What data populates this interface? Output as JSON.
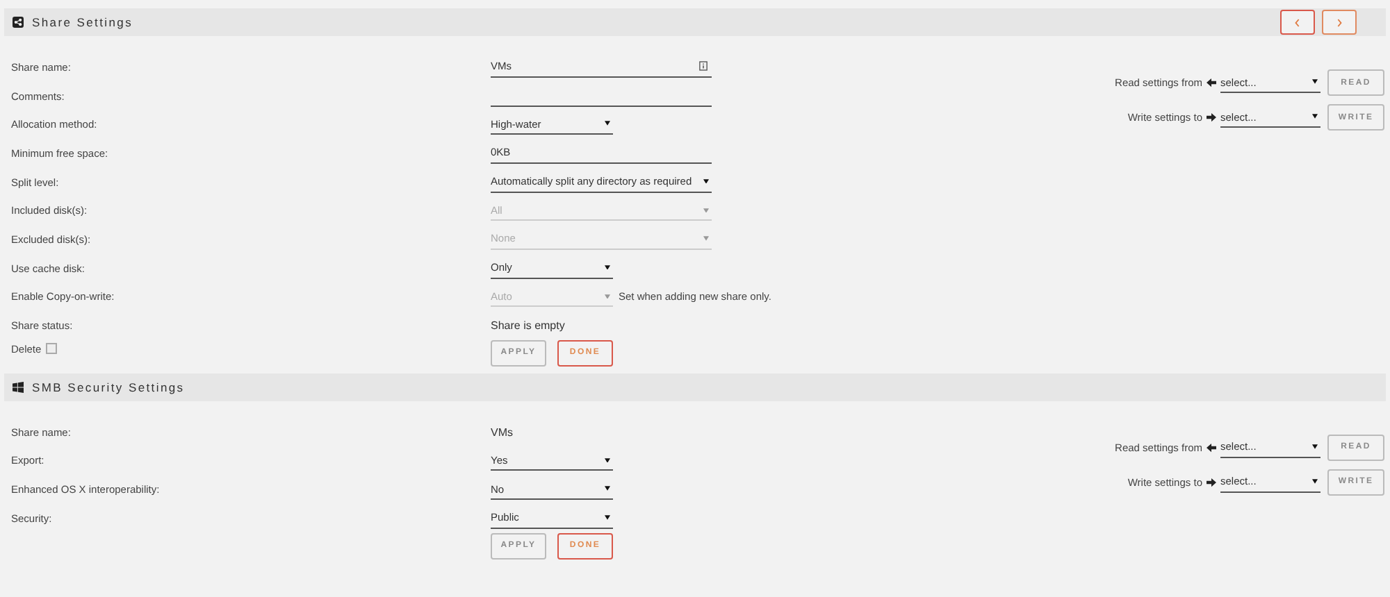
{
  "sections": [
    {
      "title": "Share Settings",
      "nav": [
        {
          "kind": "prev"
        },
        {
          "kind": "next"
        }
      ],
      "fields": [
        {
          "label": "Share name:",
          "kind": "input",
          "value": "VMs",
          "hint_icon": true
        },
        {
          "label": "Comments:",
          "kind": "input"
        },
        {
          "label": "Allocation method:",
          "kind": "select",
          "value": "High-water",
          "disabled": false
        },
        {
          "label": "Minimum free space:",
          "kind": "input",
          "value": "0KB"
        },
        {
          "label": "Split level:",
          "kind": "wide-select",
          "value": "Automatically split any directory as required",
          "disabled": false
        },
        {
          "label": "Included disk(s):",
          "kind": "wide-select",
          "value": "All",
          "disabled": true
        },
        {
          "label": "Excluded disk(s):",
          "kind": "wide-select",
          "value": "None",
          "disabled": true
        },
        {
          "label": "Use cache disk:",
          "kind": "select",
          "value": "Only",
          "disabled": false
        },
        {
          "label": "Enable Copy-on-write:",
          "kind": "select",
          "value": "Auto",
          "disabled": true,
          "note": "Set when adding new share only."
        },
        {
          "label": "Share status:",
          "kind": "text",
          "value": "Share is empty"
        }
      ],
      "delete": {
        "label": "Delete",
        "checked": false
      },
      "buttons": [
        {
          "label": "APPLY",
          "disabled": true
        },
        {
          "label": "DONE",
          "disabled": false
        }
      ],
      "copy": [
        {
          "kind": "read",
          "label": "Read settings from",
          "placeholder": "select...",
          "button": "READ"
        },
        {
          "kind": "write",
          "label": "Write settings to",
          "placeholder": "select...",
          "button": "WRITE"
        }
      ]
    },
    {
      "title": "SMB Security Settings",
      "fields": [
        {
          "label": "Share name:",
          "kind": "text",
          "value": "VMs"
        },
        {
          "label": "Export:",
          "kind": "select",
          "value": "Yes",
          "disabled": false
        },
        {
          "label": "Enhanced OS X interoperability:",
          "kind": "select",
          "value": "No",
          "disabled": false
        },
        {
          "label": "Security:",
          "kind": "select",
          "value": "Public",
          "disabled": false
        }
      ],
      "buttons": [
        {
          "label": "APPLY",
          "disabled": true
        },
        {
          "label": "DONE",
          "disabled": false
        }
      ],
      "copy": [
        {
          "kind": "read",
          "label": "Read settings from",
          "placeholder": "select...",
          "button": "READ"
        },
        {
          "kind": "write",
          "label": "Write settings to",
          "placeholder": "select...",
          "button": "WRITE"
        }
      ]
    }
  ]
}
